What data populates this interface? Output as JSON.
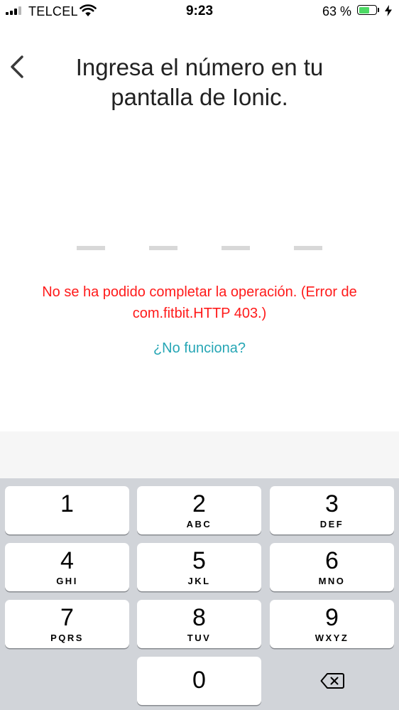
{
  "status_bar": {
    "carrier": "TELCEL",
    "time": "9:23",
    "battery_percent": "63 %",
    "battery_level": 0.63,
    "battery_color": "#4cd964",
    "signal_bars": 4,
    "signal_active": 3,
    "icons": [
      "signal-icon",
      "wifi-icon",
      "battery-icon",
      "charging-bolt-icon"
    ]
  },
  "header": {
    "back_icon": "chevron-left-icon",
    "title": "Ingresa el número en tu pantalla de Ionic."
  },
  "code_entry": {
    "slots": 4,
    "slot_color": "#d8d8d8"
  },
  "error": {
    "text": "No se ha podido completar la operación. (Error de com.fitbit.HTTP 403.)",
    "color": "#ff1a1a"
  },
  "help_link": {
    "text": "¿No funciona?",
    "color": "#26a6b5"
  },
  "keypad": {
    "keys": [
      {
        "digit": "1",
        "letters": ""
      },
      {
        "digit": "2",
        "letters": "ABC"
      },
      {
        "digit": "3",
        "letters": "DEF"
      },
      {
        "digit": "4",
        "letters": "GHI"
      },
      {
        "digit": "5",
        "letters": "JKL"
      },
      {
        "digit": "6",
        "letters": "MNO"
      },
      {
        "digit": "7",
        "letters": "PQRS"
      },
      {
        "digit": "8",
        "letters": "TUV"
      },
      {
        "digit": "9",
        "letters": "WXYZ"
      },
      {
        "digit": "0",
        "letters": ""
      }
    ],
    "delete_icon": "backspace-icon",
    "background": "#d1d4d9"
  }
}
